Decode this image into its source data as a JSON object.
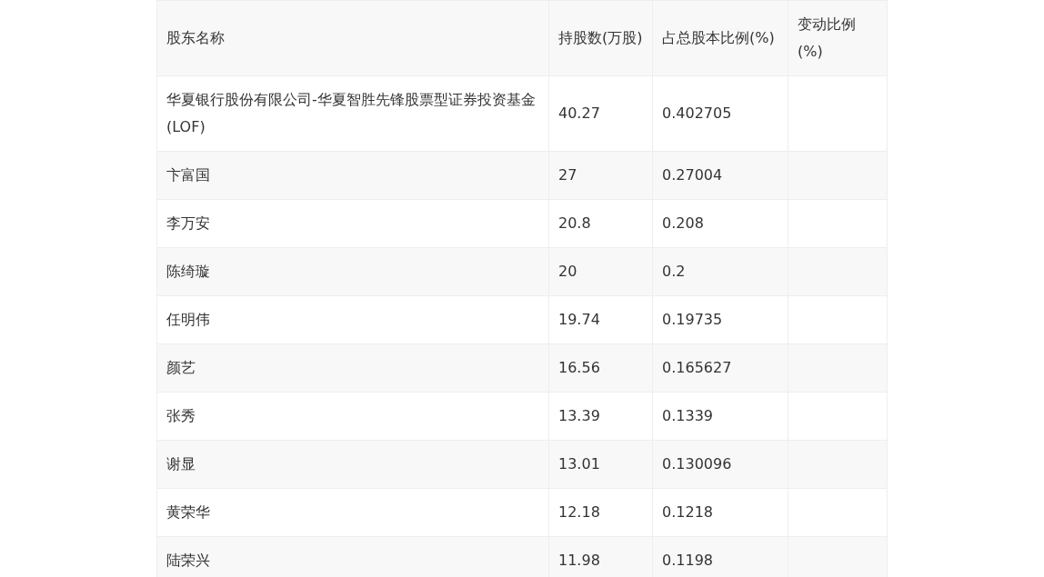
{
  "table": {
    "columns": [
      "股东名称",
      "持股数(万股)",
      "占总股本比例(%)",
      "变动比例(%)"
    ],
    "rows": [
      {
        "name": "华夏银行股份有限公司-华夏智胜先锋股票型证券投资基金(LOF)",
        "shares": "40.27",
        "ratio": "0.402705"
      },
      {
        "name": "卞富国",
        "shares": "27",
        "ratio": "0.27004"
      },
      {
        "name": "李万安",
        "shares": "20.8",
        "ratio": "0.208"
      },
      {
        "name": "陈绮璇",
        "shares": "20",
        "ratio": "0.2"
      },
      {
        "name": "任明伟",
        "shares": "19.74",
        "ratio": "0.19735"
      },
      {
        "name": "颜艺",
        "shares": "16.56",
        "ratio": "0.165627"
      },
      {
        "name": "张秀",
        "shares": "13.39",
        "ratio": "0.1339"
      },
      {
        "name": "谢显",
        "shares": "13.01",
        "ratio": "0.130096"
      },
      {
        "name": "黄荣华",
        "shares": "12.18",
        "ratio": "0.1218"
      },
      {
        "name": "陆荣兴",
        "shares": "11.98",
        "ratio": "0.1198"
      }
    ]
  }
}
